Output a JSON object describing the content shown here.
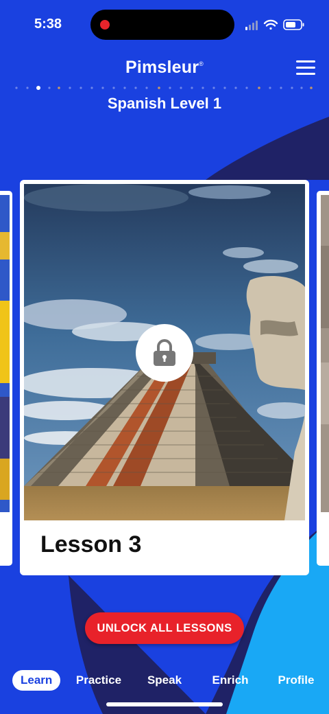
{
  "status_bar": {
    "time": "5:38"
  },
  "header": {
    "logo": "Pimsleur",
    "logo_mark": "®",
    "level_title": "Spanish Level 1"
  },
  "card": {
    "lesson_title": "Lesson 3",
    "locked": true
  },
  "unlock_label": "UNLOCK ALL LESSONS",
  "tabs": [
    {
      "label": "Learn",
      "active": true
    },
    {
      "label": "Practice"
    },
    {
      "label": "Speak"
    },
    {
      "label": "Enrich"
    },
    {
      "label": "Profile"
    }
  ],
  "colors": {
    "background": "#1a41e0",
    "dark_wave": "#1f2266",
    "light_wave": "#19a8f5",
    "accent_red": "#e8222a"
  }
}
